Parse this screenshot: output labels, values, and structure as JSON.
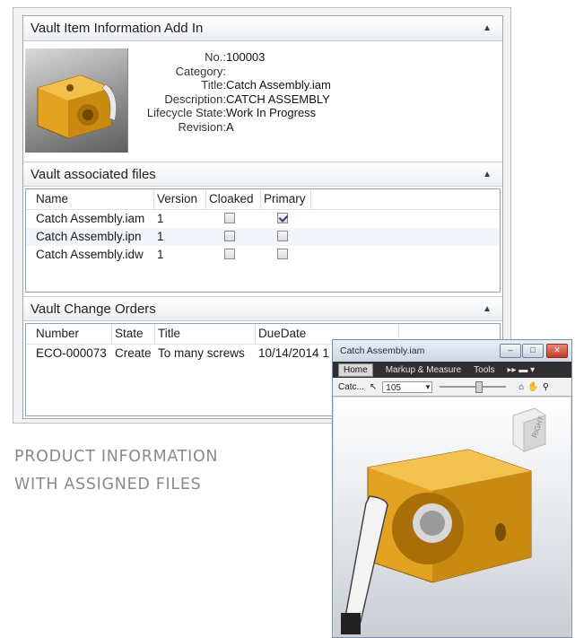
{
  "info": {
    "header": "Vault Item Information Add In",
    "props": [
      {
        "key": "No.:",
        "value": "100003"
      },
      {
        "key": "Category:",
        "value": ""
      },
      {
        "key": "Title:",
        "value": "Catch Assembly.iam"
      },
      {
        "key": "Description:",
        "value": "CATCH ASSEMBLY"
      },
      {
        "key": "Lifecycle State:",
        "value": "Work In Progress"
      },
      {
        "key": "Revision:",
        "value": "A"
      }
    ]
  },
  "files": {
    "header": "Vault associated files",
    "columns": [
      "Name",
      "Version",
      "Cloaked",
      "Primary"
    ],
    "rows": [
      {
        "name": "Catch Assembly.iam",
        "version": "1",
        "cloaked": false,
        "primary": true
      },
      {
        "name": "Catch Assembly.ipn",
        "version": "1",
        "cloaked": false,
        "primary": false
      },
      {
        "name": "Catch Assembly.idw",
        "version": "1",
        "cloaked": false,
        "primary": false
      }
    ]
  },
  "orders": {
    "header": "Vault Change Orders",
    "columns": [
      "Number",
      "State",
      "Title",
      "DueDate"
    ],
    "rows": [
      {
        "number": "ECO-000073",
        "state": "Create",
        "title": "To many screws",
        "due": "10/14/2014 1"
      }
    ]
  },
  "caption": {
    "line1": "PRODUCT INFORMATION",
    "line2": "WITH ASSIGNED FILES"
  },
  "viewer": {
    "title": "Catch Assembly.iam",
    "menu": [
      "Home",
      "Markup & Measure",
      "Tools"
    ],
    "toolbar_doc": "Catc...",
    "zoom": "105",
    "viewcube_label": "RIGHT"
  },
  "colors": {
    "part_gold": "#e3a322",
    "header_blue": "#1f3f66"
  }
}
